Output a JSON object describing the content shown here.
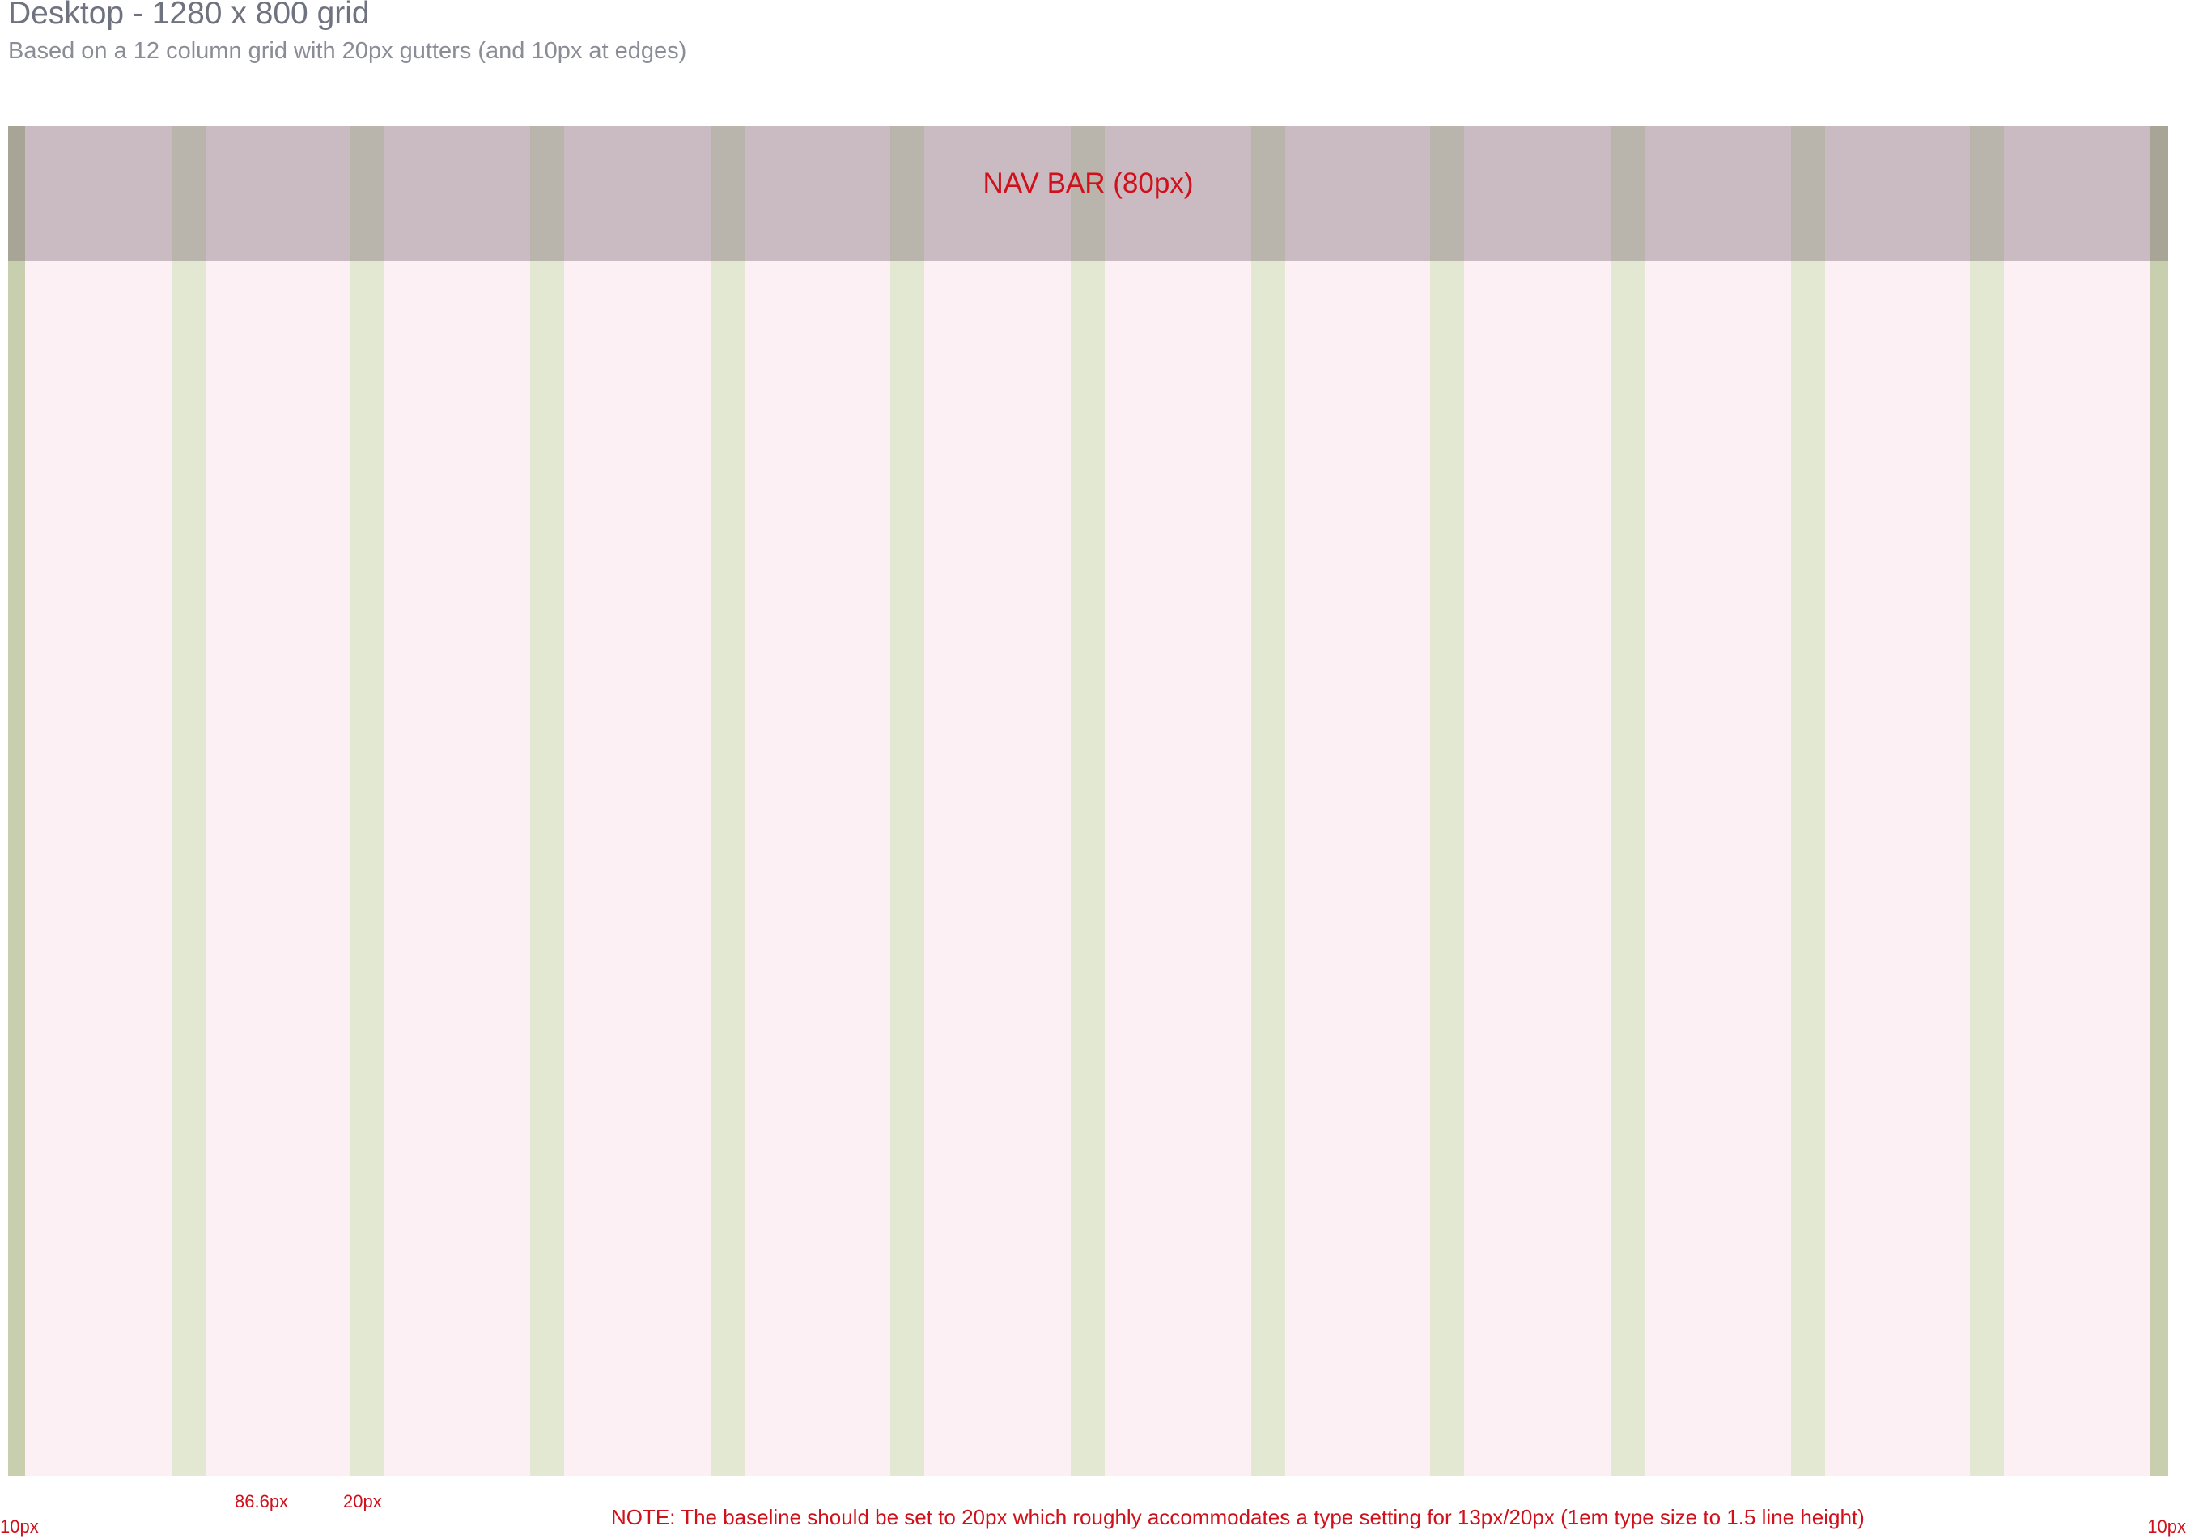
{
  "header": {
    "title": "Desktop - 1280 x 800 grid",
    "subtitle": "Based on a 12 column grid with 20px gutters (and 10px at edges)"
  },
  "grid": {
    "columns": 12,
    "gutter_label": "20px",
    "column_label": "86.6px",
    "edge_label_left": "10px",
    "edge_label_right": "10px",
    "nav_label": "NAV BAR (80px)",
    "colors": {
      "background": "#fcf0f4",
      "gutter": "#e3e8d2",
      "edge": "#c7cfaf",
      "nav": "#cbc0c5",
      "annotation": "#d0101a"
    }
  },
  "note": "NOTE: The baseline should be set to 20px which roughly accommodates a type setting for 13px/20px (1em type size to 1.5 line height)"
}
